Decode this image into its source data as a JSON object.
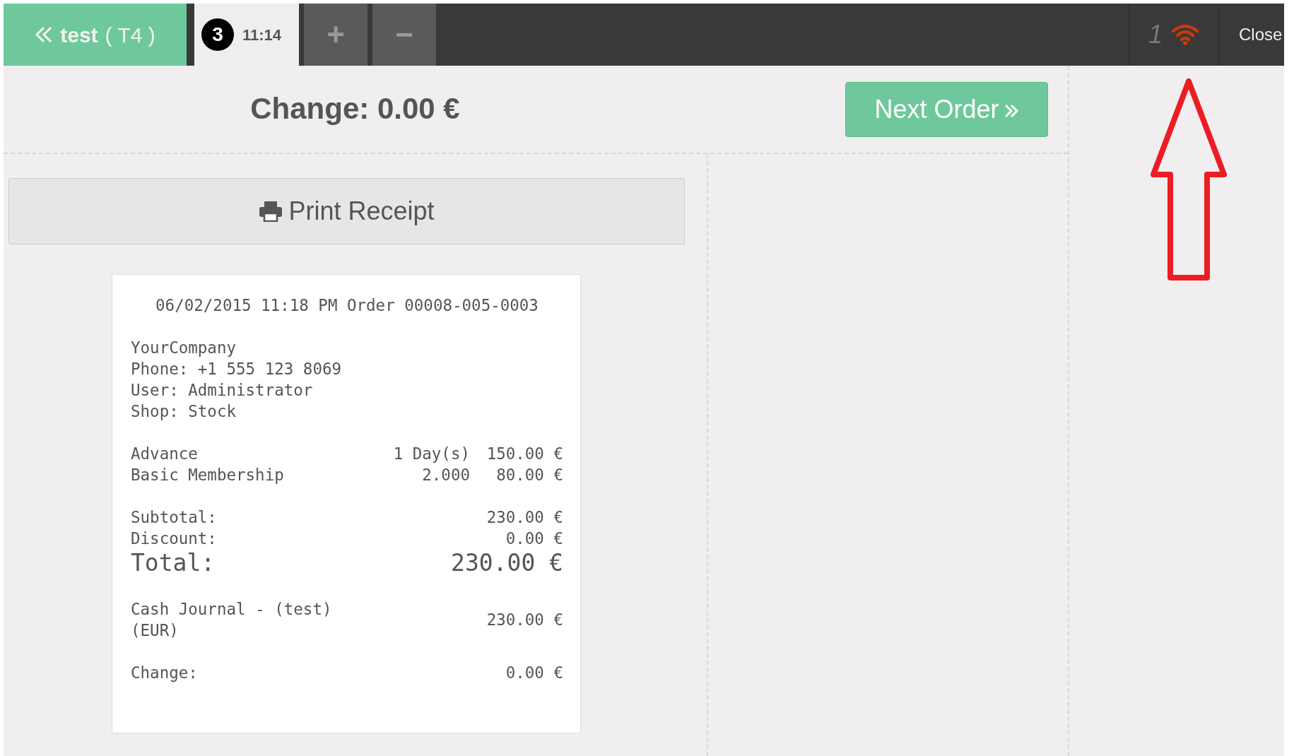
{
  "topbar": {
    "back_button": {
      "label": "test",
      "table": "( T4 )"
    },
    "orders": [
      {
        "number": "3",
        "time": "11:14",
        "selected": true
      }
    ],
    "add_button": "+",
    "remove_button": "−",
    "network": {
      "pending": "1",
      "connected": true
    },
    "close_button": "Close"
  },
  "screen": {
    "change_title": "Change: 0.00 €",
    "next_button": "Next Order",
    "print_button": "Print Receipt"
  },
  "receipt": {
    "header": "06/02/2015 11:18 PM Order 00008-005-0003",
    "company_lines": [
      "YourCompany",
      "Phone: +1 555 123 8069",
      "User: Administrator",
      "Shop: Stock"
    ],
    "orderlines": [
      {
        "name": "Advance",
        "qty": "1 Day(s)",
        "price": "150.00 €"
      },
      {
        "name": "Basic Membership",
        "qty": "2.000",
        "price": "80.00 €"
      }
    ],
    "totals": [
      {
        "label": "Subtotal:",
        "value": "230.00 €",
        "kind": "normal"
      },
      {
        "label": "Discount:",
        "value": "0.00 €",
        "kind": "normal"
      },
      {
        "label": "Total:",
        "value": "230.00 €",
        "kind": "grand"
      }
    ],
    "paymentlines": [
      {
        "name": "Cash Journal - (test) (EUR)",
        "amount": "230.00 €"
      }
    ],
    "change": {
      "label": "Change:",
      "value": "0.00 €"
    }
  }
}
